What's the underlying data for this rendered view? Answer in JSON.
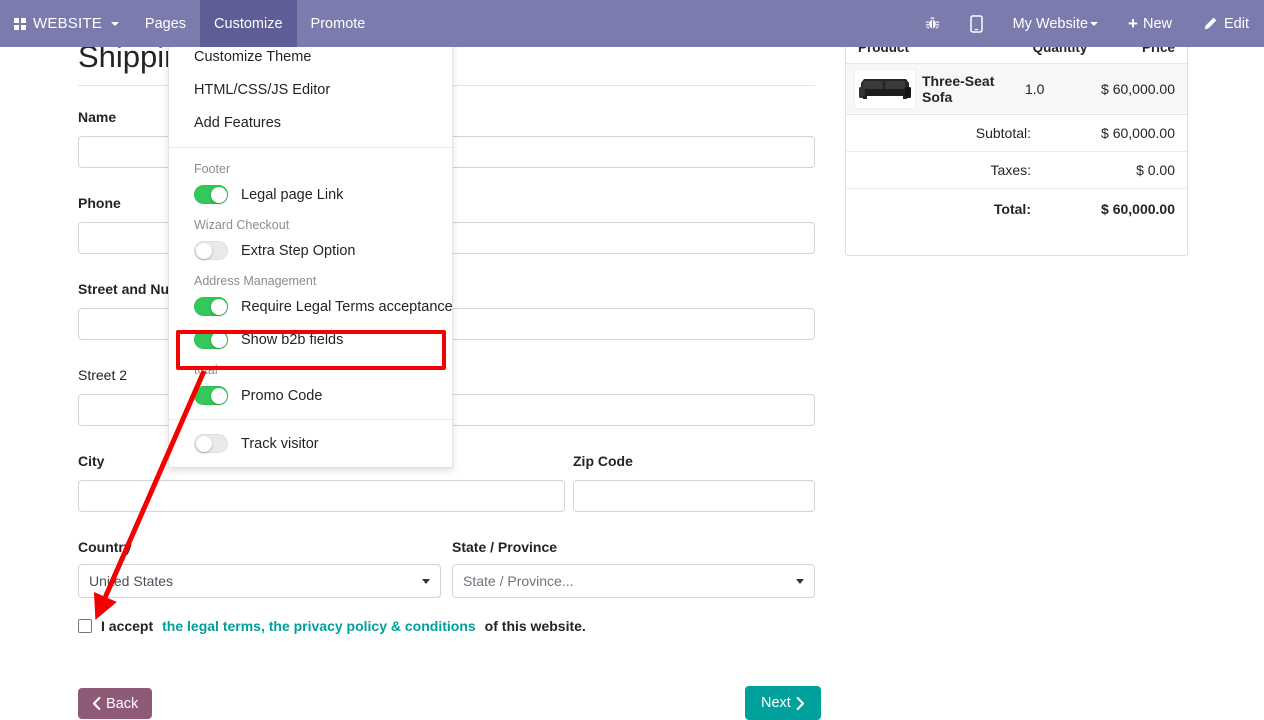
{
  "navbar": {
    "brand": "WEBSITE",
    "left_items": [
      {
        "label": "Pages",
        "active": false
      },
      {
        "label": "Customize",
        "active": true
      },
      {
        "label": "Promote",
        "active": false
      }
    ],
    "bug_icon": "bug-icon",
    "mobile_icon": "mobile-preview-icon",
    "website_selector": "My Website",
    "new_label": "New",
    "edit_label": "Edit",
    "background_color": "#7c7bad",
    "active_color": "#5f5d96"
  },
  "page": {
    "title": "Shipping Address"
  },
  "form": {
    "name": {
      "label": "Name",
      "value": ""
    },
    "phone": {
      "label": "Phone",
      "value": ""
    },
    "street": {
      "label": "Street and Number",
      "value": ""
    },
    "street2": {
      "label": "Street 2",
      "value": ""
    },
    "city": {
      "label": "City",
      "value": ""
    },
    "zip": {
      "label": "Zip Code",
      "value": ""
    },
    "country": {
      "label": "Country",
      "value": "United States"
    },
    "state": {
      "label": "State / Province",
      "value": "State / Province..."
    }
  },
  "accept": {
    "prefix": "I accept ",
    "link": "the legal terms, the privacy policy & conditions",
    "suffix": " of this website.",
    "checked": false,
    "link_color": "#00a09d"
  },
  "buttons": {
    "back": "Back",
    "next": "Next",
    "back_color": "#8f5a78",
    "next_color": "#00a09d"
  },
  "summary": {
    "headers": {
      "product": "Product",
      "quantity": "Quantity",
      "price": "Price"
    },
    "line": {
      "name": "Three-Seat Sofa",
      "qty": "1.0",
      "price": "$ 60,000.00",
      "image": "sofa-thumbnail"
    },
    "totals": [
      {
        "label": "Subtotal:",
        "value": "$ 60,000.00",
        "bold": false
      },
      {
        "label": "Taxes:",
        "value": "$ 0.00",
        "bold": false
      },
      {
        "label": "Total:",
        "value": "$ 60,000.00",
        "bold": true
      }
    ]
  },
  "dropdown": {
    "links": [
      {
        "label": "Customize Theme"
      },
      {
        "label": "HTML/CSS/JS Editor"
      },
      {
        "label": "Add Features"
      }
    ],
    "groups": [
      {
        "title": "Footer",
        "toggles": [
          {
            "label": "Legal page Link",
            "on": true
          }
        ]
      },
      {
        "title": "Wizard Checkout",
        "toggles": [
          {
            "label": "Extra Step Option",
            "on": false
          }
        ]
      },
      {
        "title": "Address Management",
        "toggles": [
          {
            "label": "Require Legal Terms acceptance",
            "on": true,
            "highlighted": true
          },
          {
            "label": "Show b2b fields",
            "on": true
          }
        ]
      },
      {
        "title": "total",
        "toggles": [
          {
            "label": "Promo Code",
            "on": true
          }
        ]
      }
    ],
    "footer_toggles": [
      {
        "label": "Track visitor",
        "on": false
      }
    ],
    "toggle_on_color": "#34c759",
    "toggle_off_color": "#e9e9ea"
  },
  "annotation": {
    "highlight_color": "#f50000",
    "arrow_from": "require-legal-terms-toggle",
    "arrow_to": "accept-legal-terms-checkbox"
  }
}
